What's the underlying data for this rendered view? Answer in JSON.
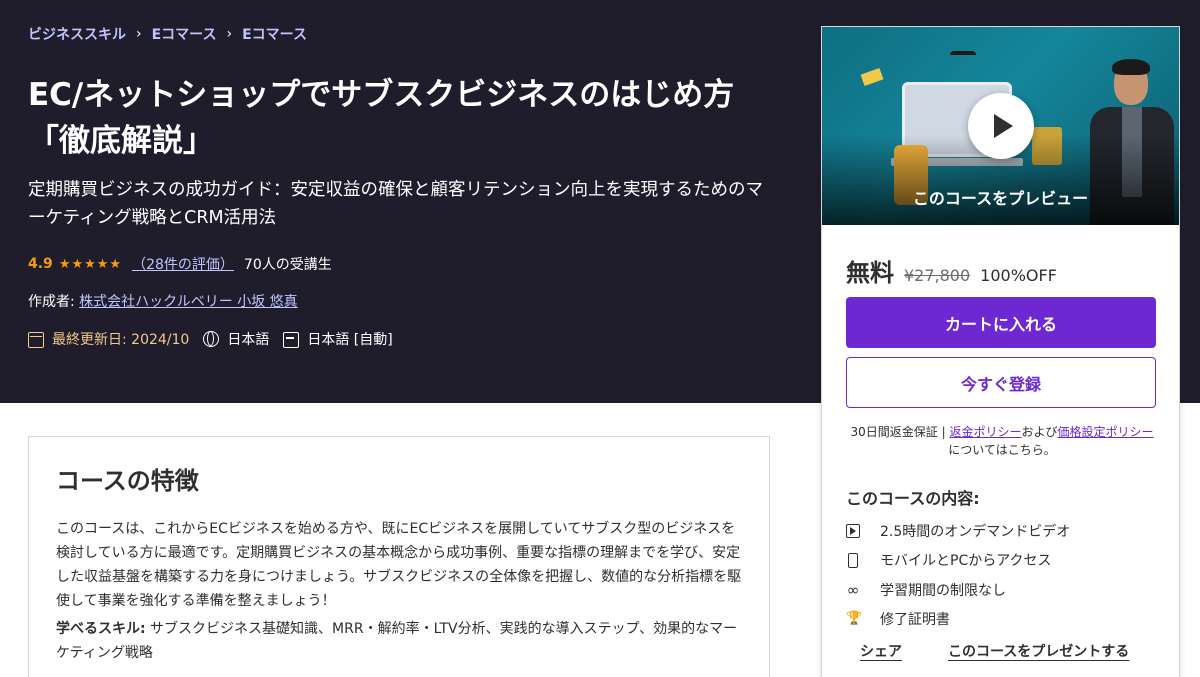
{
  "breadcrumb": [
    "ビジネススキル",
    "Eコマース",
    "Eコマース"
  ],
  "course": {
    "title": "EC/ネットショップでサブスクビジネスのはじめ方「徹底解説」",
    "subtitle": "定期購買ビジネスの成功ガイド：安定収益の確保と顧客リテンション向上を実現するためのマーケティング戦略とCRM活用法",
    "rating": "4.9",
    "stars": "★★★★★",
    "rating_count": "（28件の評価）",
    "students": "70人の受講生",
    "author_label": "作成者:",
    "author": "株式会社ハックルベリー 小坂 悠真",
    "updated": "最終更新日: 2024/10",
    "language": "日本語",
    "captions": "日本語 [自動]"
  },
  "card": {
    "preview_label": "このコースをプレビュー",
    "price_free": "無料",
    "price_original": "¥27,800",
    "discount": "100%OFF",
    "cart_button": "カートに入れる",
    "enroll_button": "今すぐ登録",
    "guarantee_prefix": "30日間返金保証 | ",
    "refund_policy": "返金ポリシー",
    "guarantee_mid": "および",
    "pricing_policy": "価格設定ポリシー",
    "guarantee_suffix": "についてはこちら。",
    "includes_title": "このコースの内容:",
    "includes": [
      {
        "icon": "video-icon",
        "label": "2.5時間のオンデマンドビデオ"
      },
      {
        "icon": "mobile-icon",
        "label": "モバイルとPCからアクセス"
      },
      {
        "icon": "infinity-icon",
        "label": "学習期間の制限なし"
      },
      {
        "icon": "trophy-icon",
        "label": "修了証明書"
      }
    ],
    "share": "シェア",
    "gift": "このコースをプレゼントする"
  },
  "features": {
    "title": "コースの特徴",
    "description": "このコースは、これからECビジネスを始める方や、既にECビジネスを展開していてサブスク型のビジネスを検討している方に最適です。定期購買ビジネスの基本概念から成功事例、重要な指標の理解までを学び、安定した収益基盤を構築する力を身につけましょう。サブスクビジネスの全体像を把握し、数値的な分析指標を駆使して事業を強化する準備を整えましょう！",
    "skills_label": "学べるスキル:",
    "skills": " サブスクビジネス基礎知識、MRR・解約率・LTV分析、実践的な導入ステップ、効果的なマーケティング戦略"
  },
  "colors": {
    "hero_bg": "#1f1d2b",
    "accent": "#6d28d2",
    "link_light": "#c0c4fc",
    "star": "#f69c08"
  }
}
